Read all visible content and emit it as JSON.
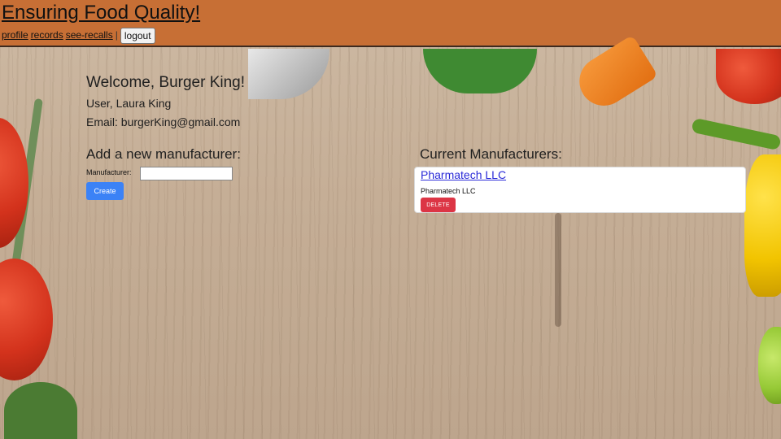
{
  "header": {
    "title": "Ensuring Food Quality!",
    "nav": {
      "profile": "profile",
      "records": "records",
      "see_recalls": "see-recalls",
      "separator": "|",
      "logout": "logout"
    }
  },
  "welcome": {
    "greeting": "Welcome, Burger King!",
    "user": "User, Laura King",
    "email": "Email: burgerKing@gmail.com"
  },
  "add_manufacturer": {
    "heading": "Add a new manufacturer:",
    "field_label": "Manufacturer:",
    "field_value": "",
    "create_label": "Create"
  },
  "current_manufacturers": {
    "heading": "Current Manufacturers:",
    "items": [
      {
        "name": "Pharmatech LLC",
        "subtitle": "Pharmatech LLC",
        "delete_label": "DELETE"
      }
    ]
  },
  "colors": {
    "header_bg": "#c76f35",
    "create_button": "#3b82f6",
    "delete_button": "#dc3545",
    "link": "#2a2ad8"
  }
}
